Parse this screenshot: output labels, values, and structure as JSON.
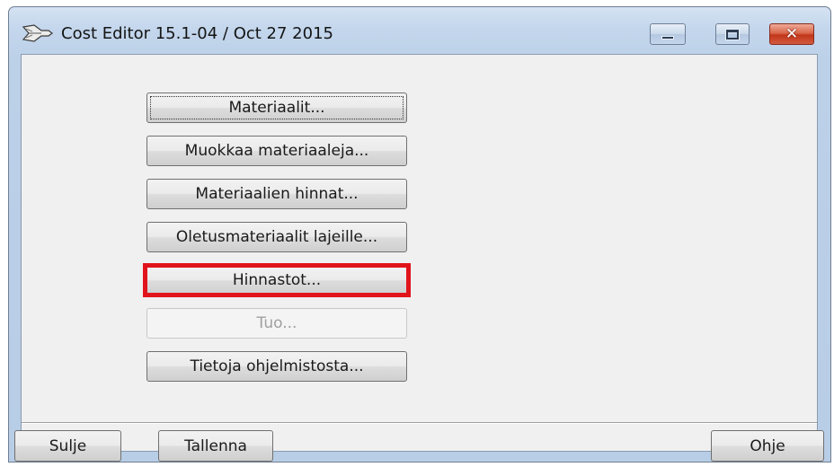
{
  "window": {
    "title": "Cost Editor 15.1-04 / Oct 27 2015",
    "icon": "app-arrow-icon",
    "controls": {
      "minimize_icon": "minimize-icon",
      "maximize_icon": "maximize-icon",
      "close_glyph": "✕",
      "close_color": "#c2361c"
    }
  },
  "menu": {
    "items": [
      {
        "label": "Materiaalit...",
        "enabled": true,
        "focused": true
      },
      {
        "label": "Muokkaa materiaaleja...",
        "enabled": true
      },
      {
        "label": "Materiaalien hinnat...",
        "enabled": true
      },
      {
        "label": "Oletusmateriaalit lajeille...",
        "enabled": true
      },
      {
        "label": "Hinnastot...",
        "enabled": true,
        "highlighted": true
      },
      {
        "label": "Tuo...",
        "enabled": false
      },
      {
        "label": "Tietoja ohjelmistosta...",
        "enabled": true
      }
    ],
    "highlight_color": "#e1141b"
  },
  "footer": {
    "close_label": "Sulje",
    "save_label": "Tallenna",
    "help_label": "Ohje"
  }
}
